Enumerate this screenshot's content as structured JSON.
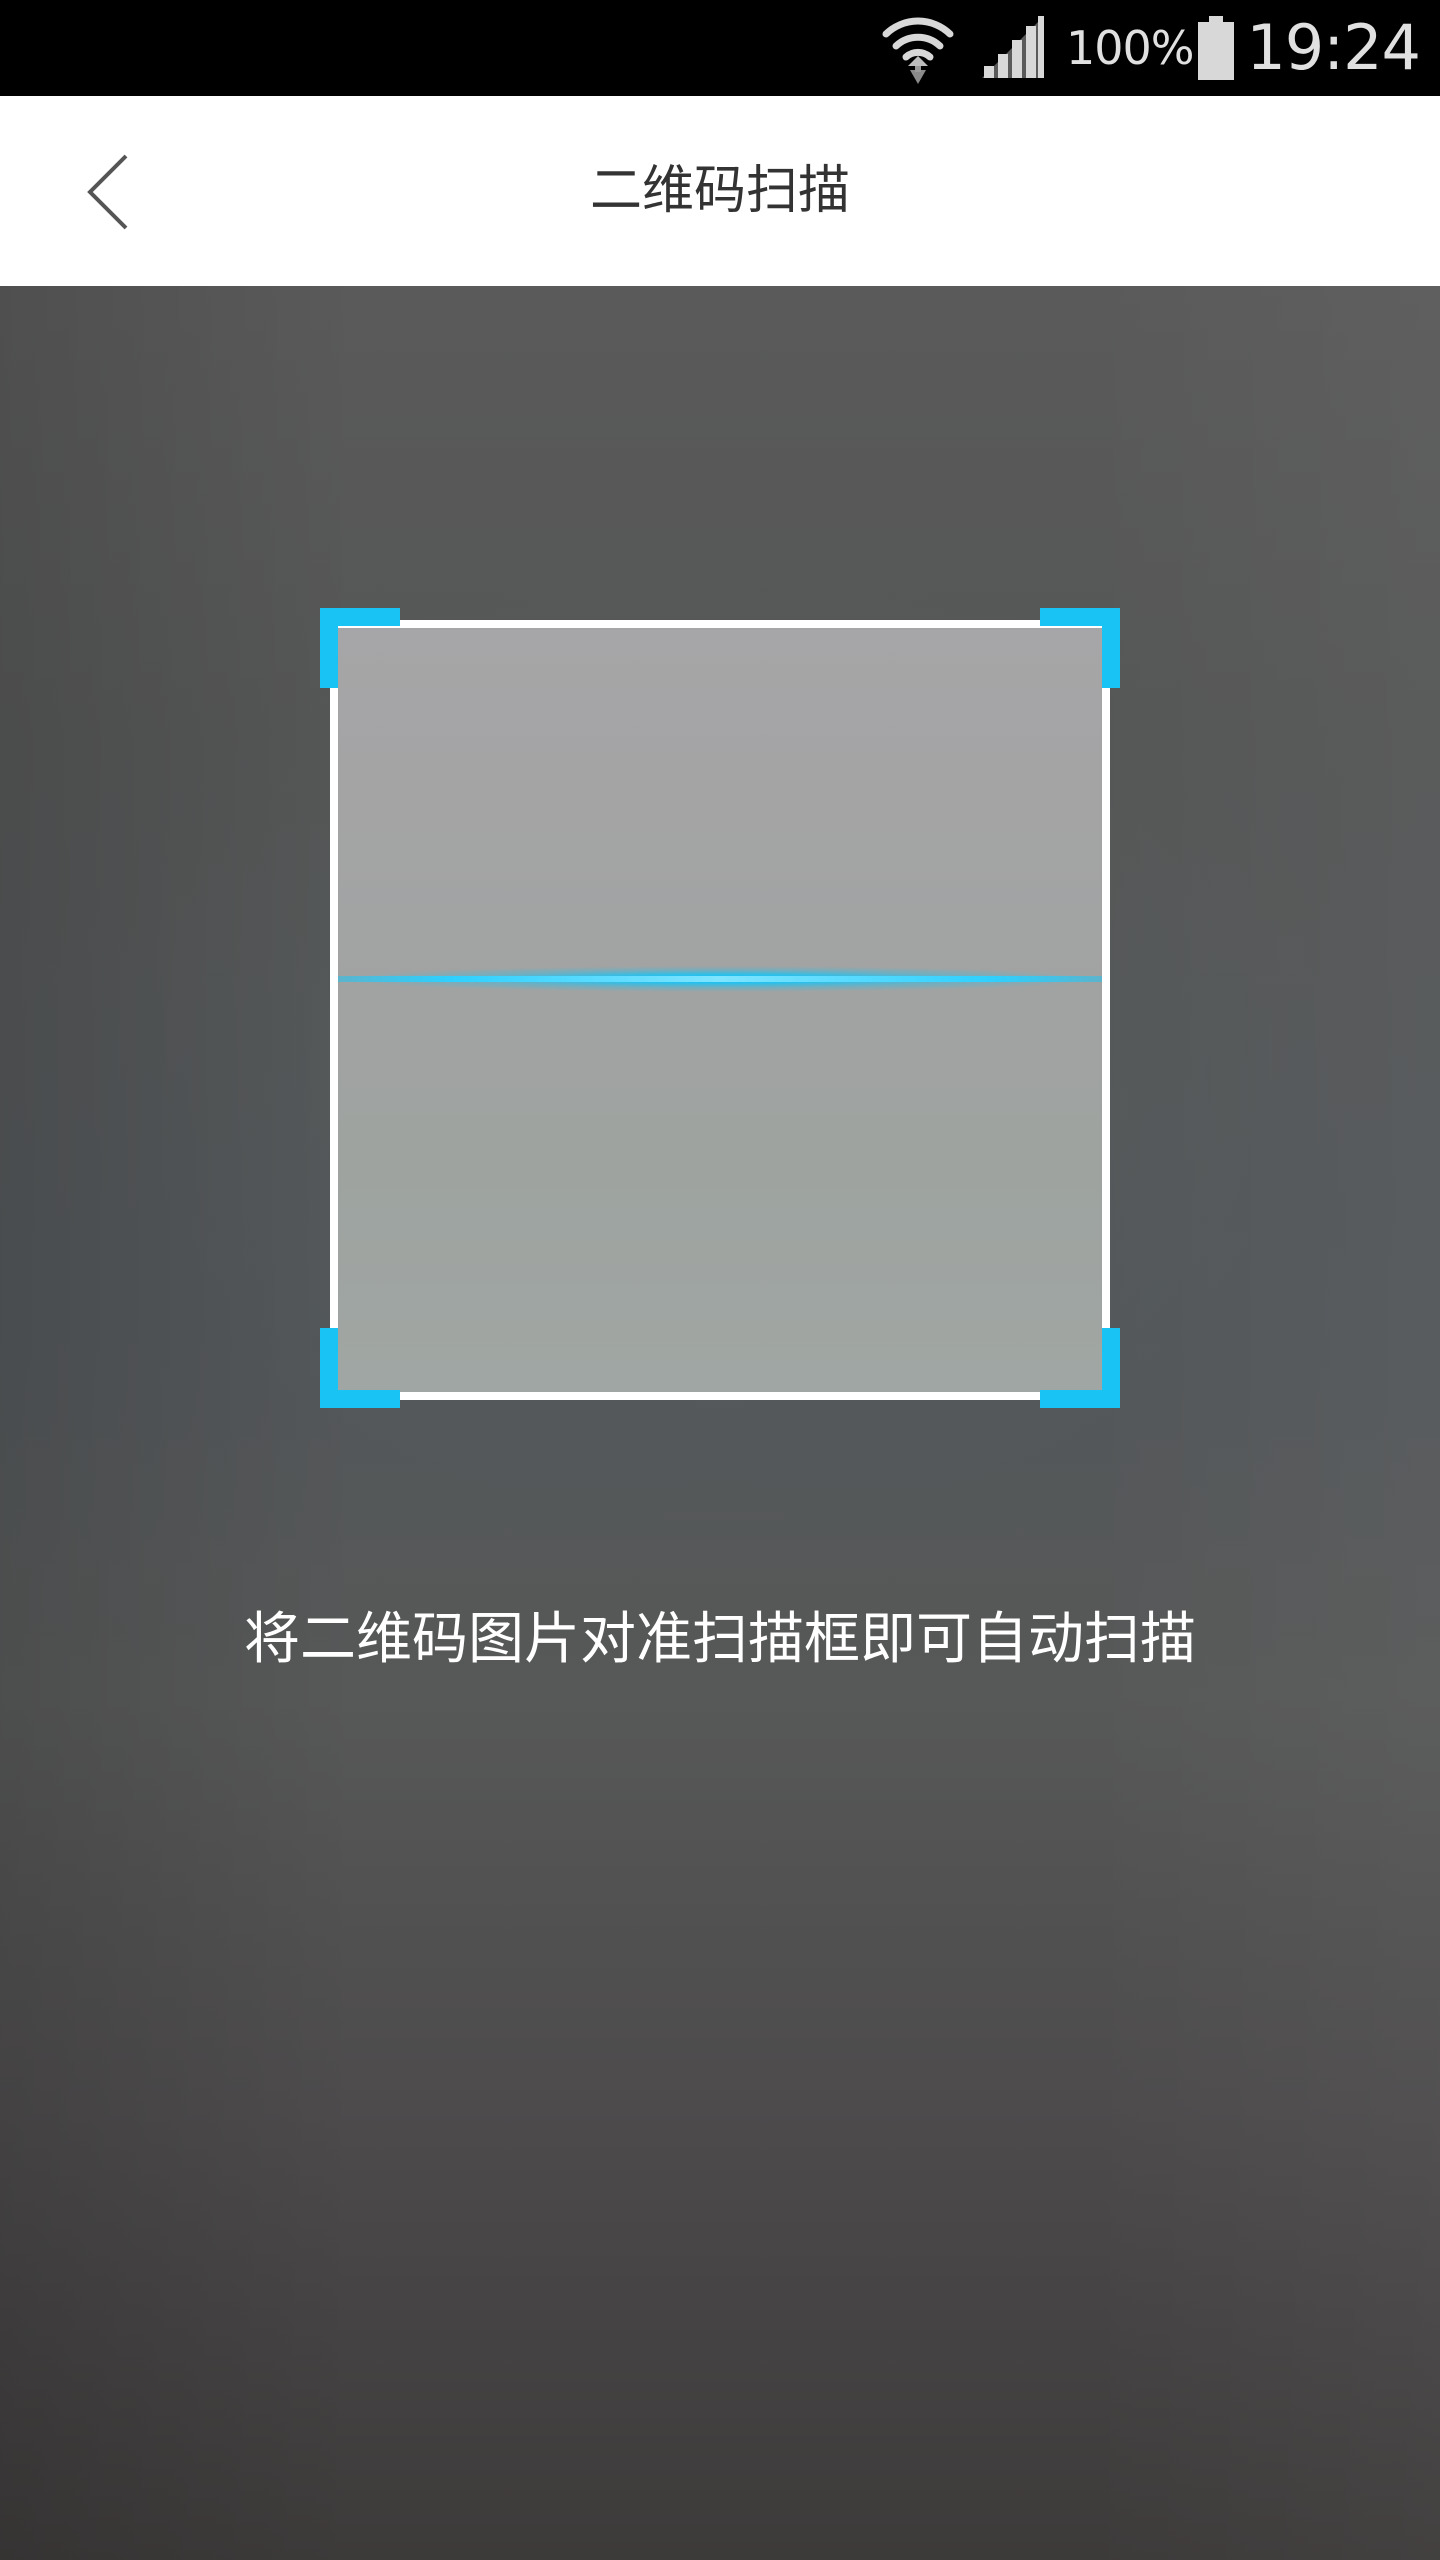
{
  "status_bar": {
    "battery_percent": "100%",
    "time": "19:24",
    "icons": [
      "wifi-icon",
      "signal-icon",
      "battery-icon"
    ]
  },
  "header": {
    "title": "二维码扫描",
    "back_icon": "chevron-left-icon"
  },
  "scanner": {
    "hint": "将二维码图片对准扫描框即可自动扫描",
    "accent_color": "#19c4f5",
    "frame_color": "#ffffff"
  },
  "colors": {
    "status_bar_bg": "#000000",
    "header_bg": "#ffffff",
    "title_text": "#333333"
  }
}
